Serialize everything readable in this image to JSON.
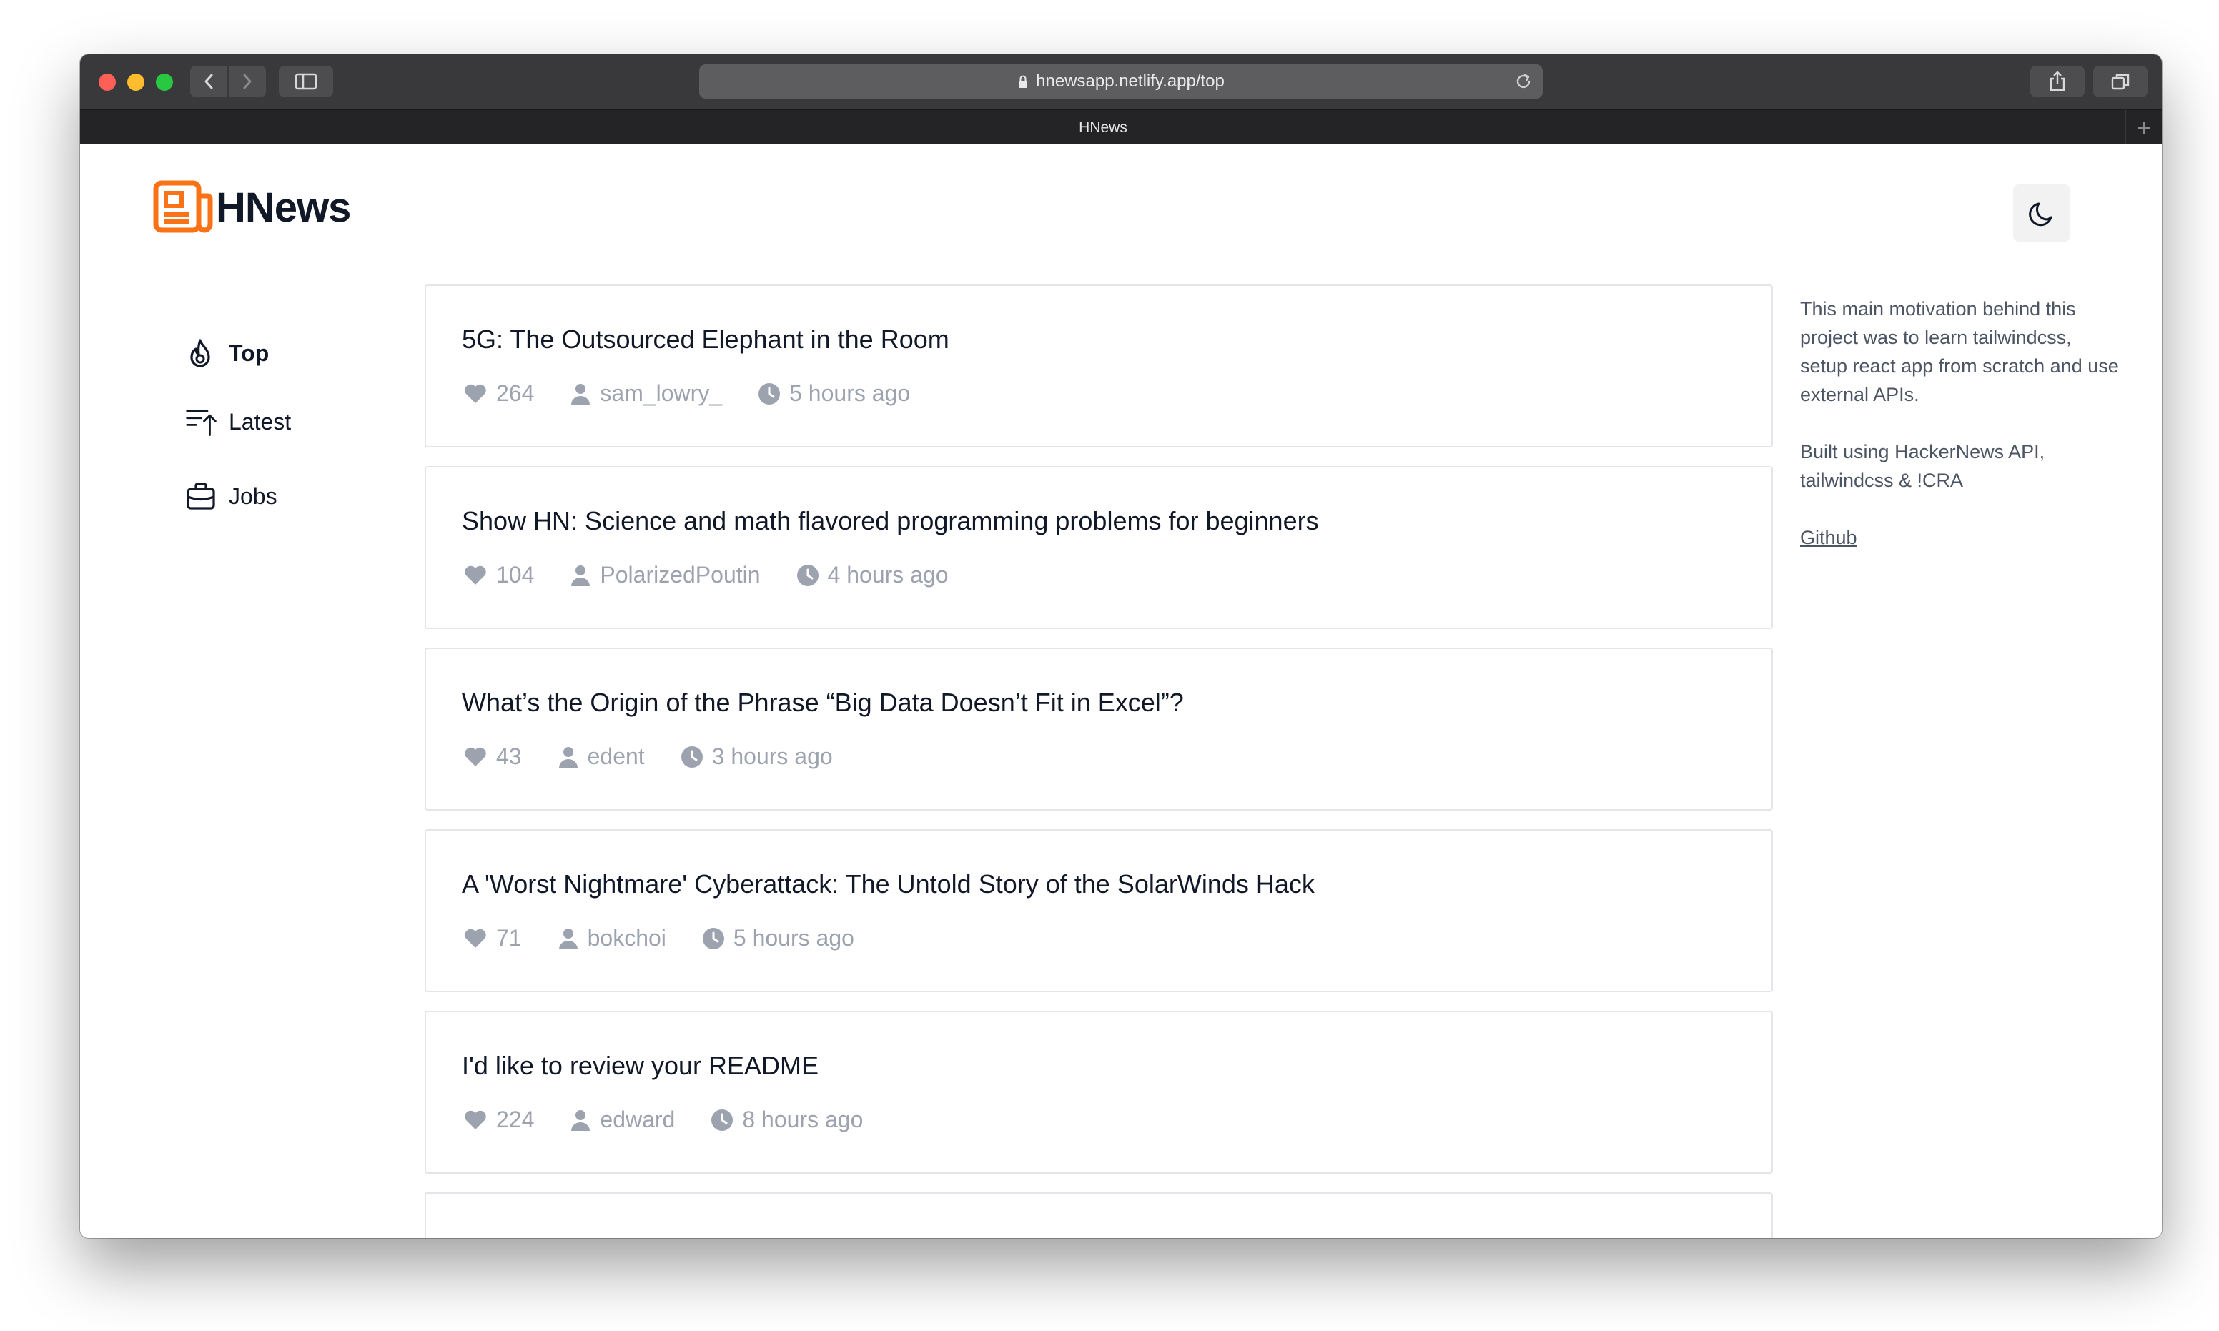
{
  "browser": {
    "url": "hnewsapp.netlify.app/top",
    "tab_title": "HNews"
  },
  "header": {
    "logo_text": "HNews",
    "theme_toggle_icon": "moon-icon"
  },
  "nav": {
    "items": [
      {
        "label": "Top",
        "icon": "fire-icon",
        "active": true
      },
      {
        "label": "Latest",
        "icon": "sort-up-icon",
        "active": false
      },
      {
        "label": "Jobs",
        "icon": "briefcase-icon",
        "active": false
      }
    ]
  },
  "stories": [
    {
      "title": "5G: The Outsourced Elephant in the Room",
      "points": "264",
      "author": "sam_lowry_",
      "time": "5 hours ago"
    },
    {
      "title": "Show HN: Science and math flavored programming problems for beginners",
      "points": "104",
      "author": "PolarizedPoutin",
      "time": "4 hours ago"
    },
    {
      "title": "What’s the Origin of the Phrase “Big Data Doesn’t Fit in Excel”?",
      "points": "43",
      "author": "edent",
      "time": "3 hours ago"
    },
    {
      "title": "A 'Worst Nightmare' Cyberattack: The Untold Story of the SolarWinds Hack",
      "points": "71",
      "author": "bokchoi",
      "time": "5 hours ago"
    },
    {
      "title": "I'd like to review your README",
      "points": "224",
      "author": "edward",
      "time": "8 hours ago"
    }
  ],
  "aside": {
    "about": "This main motivation behind this project was to learn tailwindcss, setup react app from scratch and use external APIs.",
    "built_with": "Built using HackerNews API, tailwindcss & !CRA",
    "github_link": "Github"
  },
  "colors": {
    "brand": "#f97316",
    "text": "#111827",
    "muted": "#9ca3af"
  }
}
